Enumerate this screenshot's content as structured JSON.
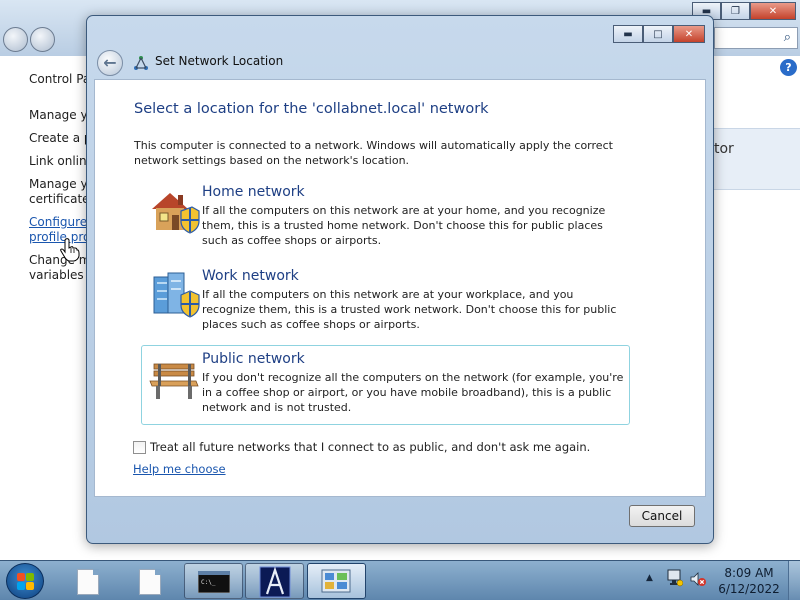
{
  "background_window": {
    "breadcrumb": "Control Pa",
    "sidebar_items": [
      {
        "line1": "Manage yo",
        "line2": "",
        "is_link": false
      },
      {
        "line1": "Create a pa",
        "line2": "",
        "is_link": false
      },
      {
        "line1": "Link online",
        "line2": "",
        "is_link": false
      },
      {
        "line1": "Manage yo",
        "line2": "certificates",
        "is_link": false
      },
      {
        "line1": "Configure",
        "line2": "profile pro",
        "is_link": true
      },
      {
        "line1": "Change my",
        "line2": "variables",
        "is_link": false
      }
    ],
    "right_box_text": "tor",
    "help_symbol": "?",
    "search_symbol": "⌕"
  },
  "dialog": {
    "title": "Set Network Location",
    "heading": "Select a location for the 'collabnet.local' network",
    "intro": "This computer is connected to a network. Windows will automatically apply the correct network settings based on the network's location.",
    "options": [
      {
        "icon": "home-network-icon",
        "title": "Home network",
        "description": "If all the computers on this network are at your home, and you recognize them, this is a trusted home network.  Don't choose this for public places such as coffee shops or airports.",
        "selected": false
      },
      {
        "icon": "work-network-icon",
        "title": "Work network",
        "description": "If all the computers on this network are at your workplace, and you recognize them, this is a trusted work network.  Don't choose this for public places such as coffee shops or airports.",
        "selected": false
      },
      {
        "icon": "park-bench-icon",
        "title": "Public network",
        "description": "If you don't recognize all the computers on the network (for example, you're in a coffee shop or airport, or you have mobile broadband), this is a public network and is not trusted.",
        "selected": true
      }
    ],
    "checkbox": {
      "label": "Treat all future networks that I connect to as public, and don't ask me again.",
      "checked": false
    },
    "help_link": "Help me choose",
    "cancel_label": "Cancel"
  },
  "taskbar": {
    "time": "8:09 AM",
    "date": "6/12/2022",
    "tray_arrow": "▲"
  },
  "colors": {
    "heading_blue": "#1e3f84",
    "link_blue": "#1a56ae",
    "selected_border": "#8fd3e0",
    "close_red": "#c4422b"
  }
}
